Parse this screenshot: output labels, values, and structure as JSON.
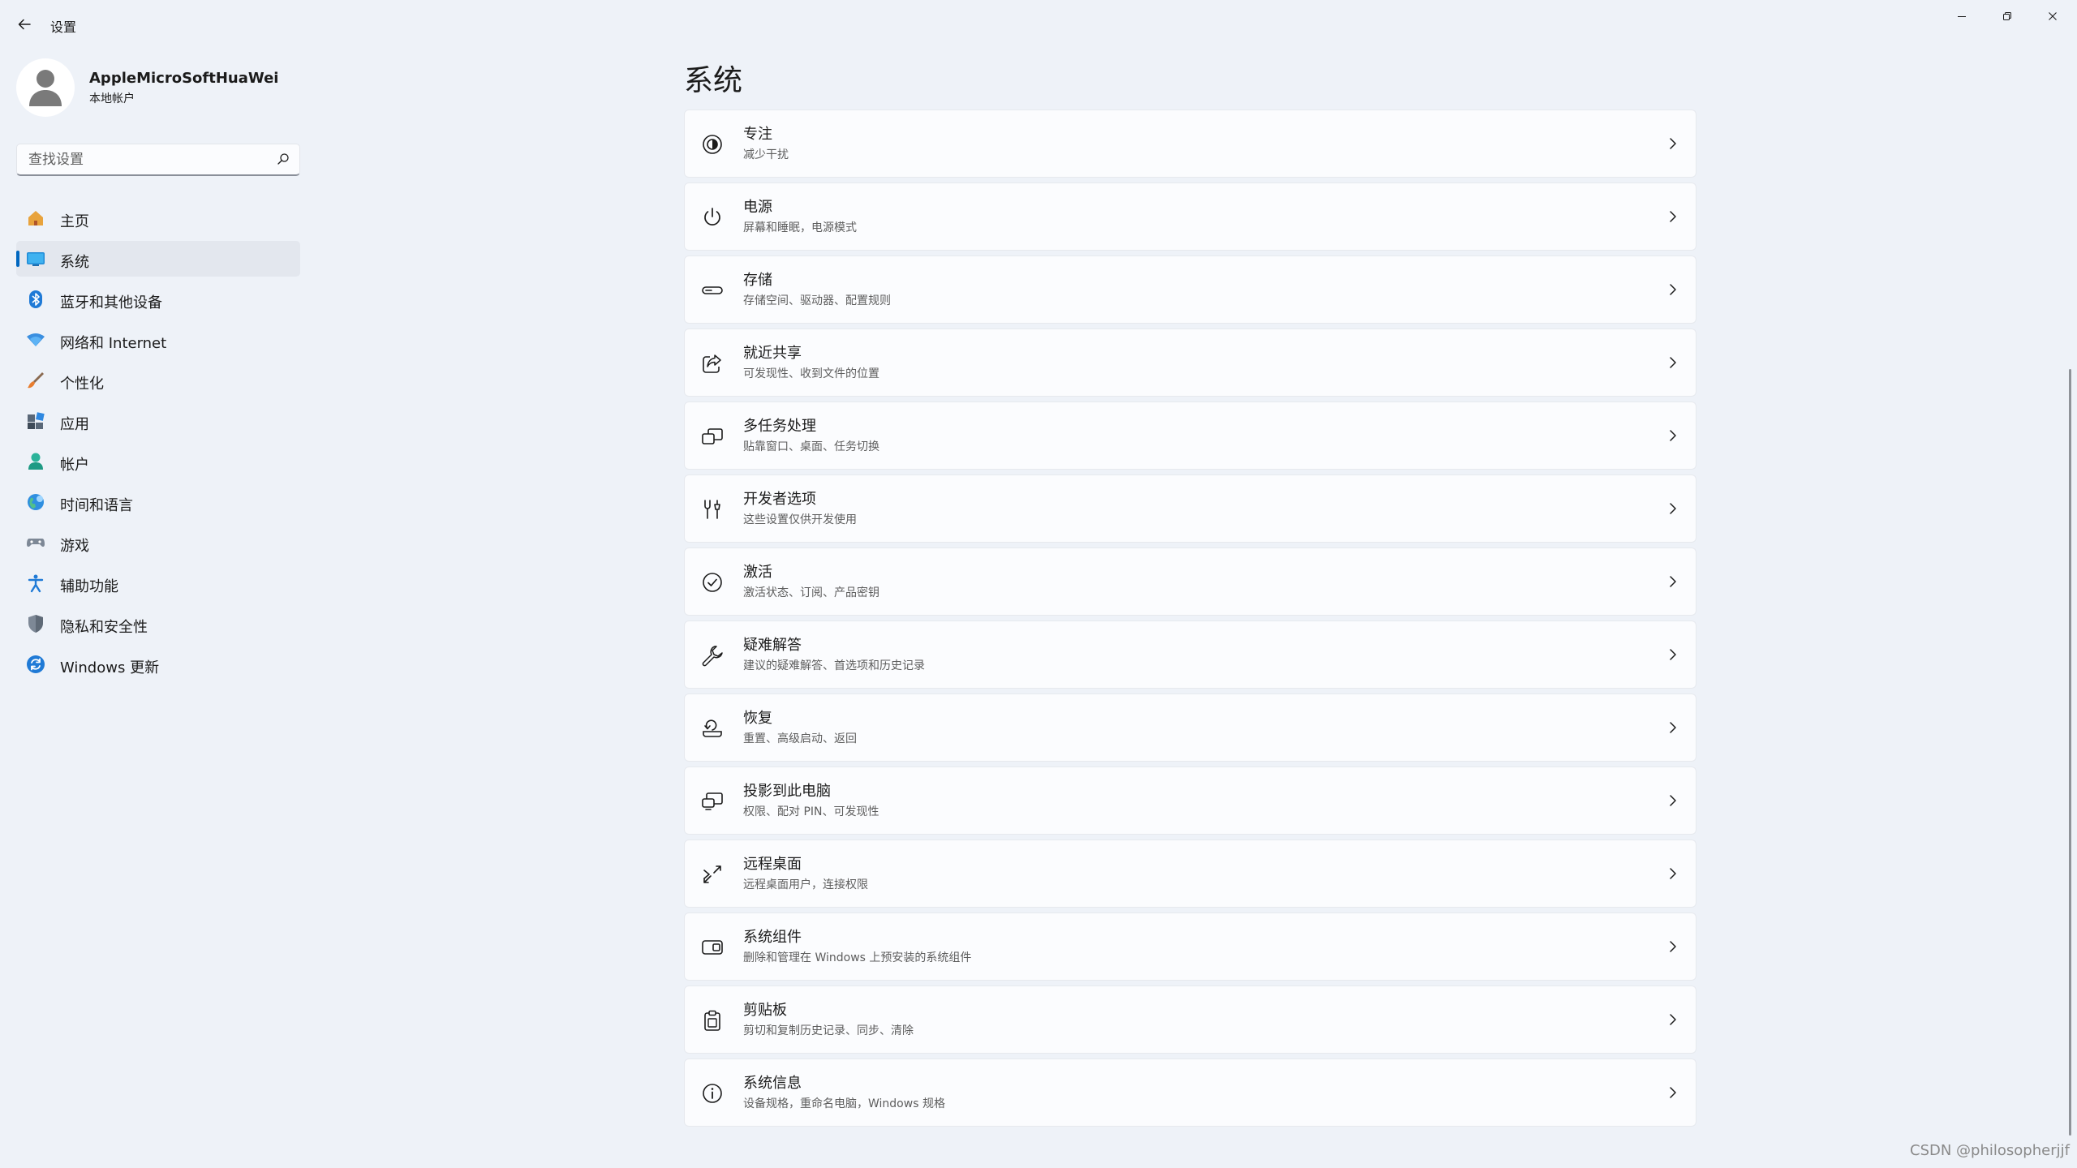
{
  "window": {
    "title": "设置"
  },
  "account": {
    "name": "AppleMicroSoftHuaWei",
    "type": "本地帐户"
  },
  "search": {
    "placeholder": "查找设置"
  },
  "sidebar": {
    "items": [
      {
        "label": "主页",
        "icon": "home-icon",
        "selected": false
      },
      {
        "label": "系统",
        "icon": "system-icon",
        "selected": true
      },
      {
        "label": "蓝牙和其他设备",
        "icon": "bluetooth-icon",
        "selected": false
      },
      {
        "label": "网络和 Internet",
        "icon": "network-icon",
        "selected": false
      },
      {
        "label": "个性化",
        "icon": "brush-icon",
        "selected": false
      },
      {
        "label": "应用",
        "icon": "apps-icon",
        "selected": false
      },
      {
        "label": "帐户",
        "icon": "account-icon",
        "selected": false
      },
      {
        "label": "时间和语言",
        "icon": "globe-icon",
        "selected": false
      },
      {
        "label": "游戏",
        "icon": "gamepad-icon",
        "selected": false
      },
      {
        "label": "辅助功能",
        "icon": "accessibility-icon",
        "selected": false
      },
      {
        "label": "隐私和安全性",
        "icon": "shield-icon",
        "selected": false
      },
      {
        "label": "Windows 更新",
        "icon": "windows-update-icon",
        "selected": false
      }
    ]
  },
  "main": {
    "title": "系统",
    "cards": [
      {
        "title": "专注",
        "subtitle": "减少干扰",
        "icon": "focus-icon"
      },
      {
        "title": "电源",
        "subtitle": "屏幕和睡眠，电源模式",
        "icon": "power-icon"
      },
      {
        "title": "存储",
        "subtitle": "存储空间、驱动器、配置规则",
        "icon": "storage-icon"
      },
      {
        "title": "就近共享",
        "subtitle": "可发现性、收到文件的位置",
        "icon": "share-icon"
      },
      {
        "title": "多任务处理",
        "subtitle": "贴靠窗口、桌面、任务切换",
        "icon": "multitasking-icon"
      },
      {
        "title": "开发者选项",
        "subtitle": "这些设置仅供开发使用",
        "icon": "developer-tools-icon"
      },
      {
        "title": "激活",
        "subtitle": "激活状态、订阅、产品密钥",
        "icon": "activation-check-icon"
      },
      {
        "title": "疑难解答",
        "subtitle": "建议的疑难解答、首选项和历史记录",
        "icon": "wrench-icon"
      },
      {
        "title": "恢复",
        "subtitle": "重置、高级启动、返回",
        "icon": "recovery-icon"
      },
      {
        "title": "投影到此电脑",
        "subtitle": "权限、配对 PIN、可发现性",
        "icon": "projection-icon"
      },
      {
        "title": "远程桌面",
        "subtitle": "远程桌面用户，连接权限",
        "icon": "remote-desktop-icon"
      },
      {
        "title": "系统组件",
        "subtitle": "删除和管理在 Windows 上预安装的系统组件",
        "icon": "system-components-icon"
      },
      {
        "title": "剪贴板",
        "subtitle": "剪切和复制历史记录、同步、清除",
        "icon": "clipboard-icon"
      },
      {
        "title": "系统信息",
        "subtitle": "设备规格，重命名电脑，Windows 规格",
        "icon": "info-icon"
      }
    ]
  },
  "watermark": "CSDN @philosopherjjf",
  "colors": {
    "accent": "#0067c0",
    "background": "#eef2f8",
    "card": "#fbfcfe"
  }
}
